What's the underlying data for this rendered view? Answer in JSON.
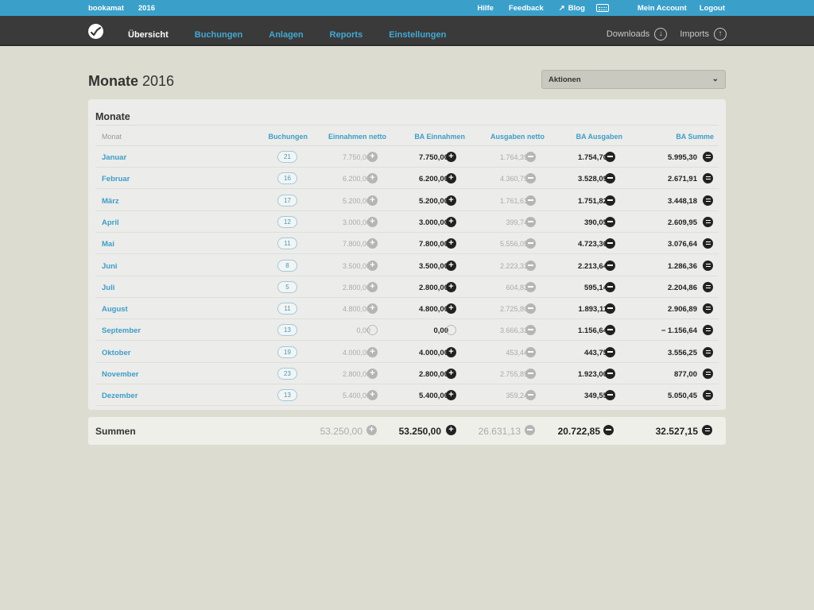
{
  "topbar": {
    "brand": "bookamat",
    "year": "2016",
    "links": [
      "Hilfe",
      "Feedback",
      "Blog",
      "Mein Account",
      "Logout"
    ]
  },
  "nav": {
    "items": [
      "Übersicht",
      "Buchungen",
      "Anlagen",
      "Reports",
      "Einstellungen"
    ],
    "downloads": "Downloads",
    "imports": "Imports"
  },
  "page": {
    "title_bold": "Monate",
    "title_year": "2016",
    "actions_label": "Aktionen"
  },
  "table": {
    "heading": "Monate",
    "columns": [
      "Monat",
      "Buchungen",
      "Einnahmen netto",
      "BA Einnahmen",
      "Ausgaben netto",
      "BA Ausgaben",
      "BA Summe"
    ],
    "rows": [
      {
        "month": "Januar",
        "count": "21",
        "in_net": "7.750,00",
        "ba_in": "7.750,00",
        "out_net": "1.764,39",
        "ba_out": "1.754,70",
        "ba_sum": "5.995,30"
      },
      {
        "month": "Februar",
        "count": "16",
        "in_net": "6.200,00",
        "ba_in": "6.200,00",
        "out_net": "4.360,79",
        "ba_out": "3.528,09",
        "ba_sum": "2.671,91"
      },
      {
        "month": "März",
        "count": "17",
        "in_net": "5.200,00",
        "ba_in": "5.200,00",
        "out_net": "1.761,61",
        "ba_out": "1.751,82",
        "ba_sum": "3.448,18"
      },
      {
        "month": "April",
        "count": "12",
        "in_net": "3.000,00",
        "ba_in": "3.000,00",
        "out_net": "399,74",
        "ba_out": "390,05",
        "ba_sum": "2.609,95"
      },
      {
        "month": "Mai",
        "count": "11",
        "in_net": "7.800,00",
        "ba_in": "7.800,00",
        "out_net": "5.556,05",
        "ba_out": "4.723,36",
        "ba_sum": "3.076,64"
      },
      {
        "month": "Juni",
        "count": "8",
        "in_net": "3.500,00",
        "ba_in": "3.500,00",
        "out_net": "2.223,33",
        "ba_out": "2.213,64",
        "ba_sum": "1.286,36"
      },
      {
        "month": "Juli",
        "count": "5",
        "in_net": "2.800,00",
        "ba_in": "2.800,00",
        "out_net": "604,83",
        "ba_out": "595,14",
        "ba_sum": "2.204,86"
      },
      {
        "month": "August",
        "count": "11",
        "in_net": "4.800,00",
        "ba_in": "4.800,00",
        "out_net": "2.725,80",
        "ba_out": "1.893,11",
        "ba_sum": "2.906,89"
      },
      {
        "month": "September",
        "count": "13",
        "in_net": "0,00",
        "ba_in": "0,00",
        "out_net": "3.666,33",
        "ba_out": "1.156,64",
        "ba_sum": "− 1.156,64"
      },
      {
        "month": "Oktober",
        "count": "19",
        "in_net": "4.000,00",
        "ba_in": "4.000,00",
        "out_net": "453,44",
        "ba_out": "443,75",
        "ba_sum": "3.556,25"
      },
      {
        "month": "November",
        "count": "23",
        "in_net": "2.800,00",
        "ba_in": "2.800,00",
        "out_net": "2.755,89",
        "ba_out": "1.923,00",
        "ba_sum": "877,00"
      },
      {
        "month": "Dezember",
        "count": "13",
        "in_net": "5.400,00",
        "ba_in": "5.400,00",
        "out_net": "359,24",
        "ba_out": "349,55",
        "ba_sum": "5.050,45"
      }
    ]
  },
  "sums": {
    "label": "Summen",
    "in_net": "53.250,00",
    "ba_in": "53.250,00",
    "out_net": "26.631,13",
    "ba_out": "20.722,85",
    "ba_sum": "32.527,15"
  }
}
